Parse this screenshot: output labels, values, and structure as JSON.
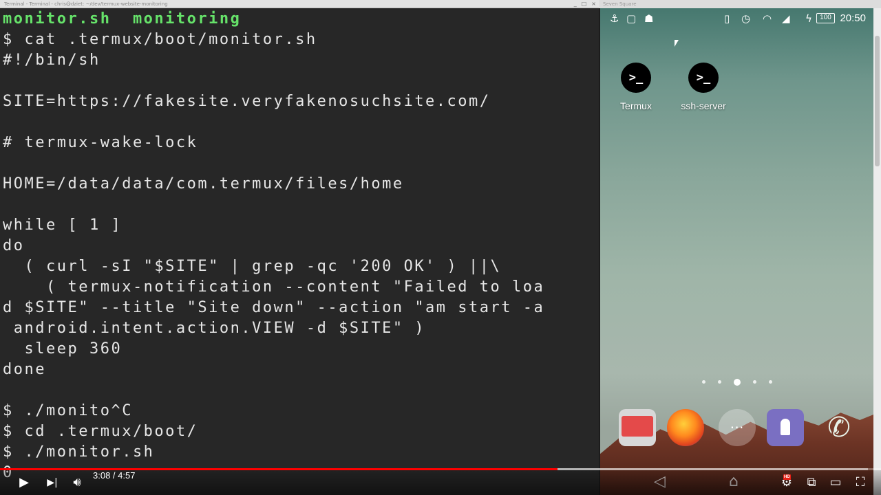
{
  "terminal": {
    "window_title": "Terminal - Terminal - chris@dziet: ~/dev/termux-website-monitoring",
    "window_controls": [
      "_",
      "□",
      "×"
    ],
    "lines": [
      {
        "text": "monitor.sh  monitoring",
        "style": "green"
      },
      {
        "text": "$ cat .termux/boot/monitor.sh",
        "style": "normal"
      },
      {
        "text": "#!/bin/sh",
        "style": "normal"
      },
      {
        "text": "",
        "style": "normal"
      },
      {
        "text": "SITE=https://fakesite.veryfakenosuchsite.com/",
        "style": "normal"
      },
      {
        "text": "",
        "style": "normal"
      },
      {
        "text": "# termux-wake-lock",
        "style": "normal"
      },
      {
        "text": "",
        "style": "normal"
      },
      {
        "text": "HOME=/data/data/com.termux/files/home",
        "style": "normal"
      },
      {
        "text": "",
        "style": "normal"
      },
      {
        "text": "while [ 1 ]",
        "style": "normal"
      },
      {
        "text": "do",
        "style": "normal"
      },
      {
        "text": "  ( curl -sI \"$SITE\" | grep -qc '200 OK' ) ||\\",
        "style": "normal"
      },
      {
        "text": "    ( termux-notification --content \"Failed to loa",
        "style": "normal"
      },
      {
        "text": "d $SITE\" --title \"Site down\" --action \"am start -a",
        "style": "normal"
      },
      {
        "text": " android.intent.action.VIEW -d $SITE\" )",
        "style": "normal"
      },
      {
        "text": "  sleep 360",
        "style": "normal"
      },
      {
        "text": "done",
        "style": "normal"
      },
      {
        "text": "",
        "style": "normal"
      },
      {
        "text": "$ ./monito^C",
        "style": "normal"
      },
      {
        "text": "$ cd .termux/boot/",
        "style": "normal"
      },
      {
        "text": "$ ./monitor.sh",
        "style": "normal"
      },
      {
        "text": "0",
        "style": "normal"
      }
    ]
  },
  "phone": {
    "window_title": "Seven Square",
    "status_bar": {
      "left_icons": [
        "usb-icon",
        "screenshot-icon",
        "android-debug-icon"
      ],
      "right_icons": [
        "vibrate-icon",
        "alarm-icon",
        "wifi-icon",
        "signal-icon",
        "charging-icon"
      ],
      "battery": "100",
      "time": "20:50"
    },
    "apps": [
      {
        "label": "Termux",
        "glyph": ">_"
      },
      {
        "label": "ssh-server",
        "glyph": ">_"
      }
    ],
    "page_count": 5,
    "active_page": 3,
    "dock": [
      "mail-app-icon",
      "firefox-icon",
      "app-drawer-icon",
      "lock-app-icon",
      "phone-app-icon"
    ],
    "nav": [
      "back-icon",
      "home-icon"
    ]
  },
  "player": {
    "current_time": "3:08",
    "duration": "4:57",
    "time_display": "3:08 / 4:57",
    "progress_fraction": 0.633,
    "buffered_fraction": 0.985,
    "hd_badge": "HD"
  }
}
